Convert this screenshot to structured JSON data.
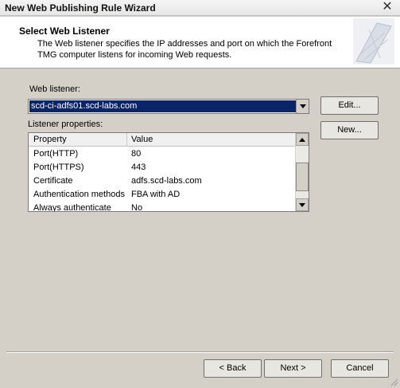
{
  "window": {
    "title": "New Web Publishing Rule Wizard",
    "close_glyph": "✕"
  },
  "header": {
    "title": "Select Web Listener",
    "description": "The Web listener specifies the IP addresses and port on which the Forefront TMG computer listens for incoming Web requests."
  },
  "web_listener": {
    "label": "Web listener:",
    "selected": "scd-ci-adfs01.scd-labs.com",
    "edit_label": "Edit...",
    "new_label": "New..."
  },
  "listener_properties": {
    "label": "Listener properties:",
    "columns": [
      "Property",
      "Value"
    ],
    "rows": [
      {
        "property": "Port(HTTP)",
        "value": "80"
      },
      {
        "property": "Port(HTTPS)",
        "value": "443"
      },
      {
        "property": "Certificate",
        "value": "adfs.scd-labs.com"
      },
      {
        "property": "Authentication methods",
        "value": "FBA with AD"
      },
      {
        "property": "Always authenticate",
        "value": "No"
      }
    ]
  },
  "footer": {
    "back_label": "< Back",
    "next_label": "Next >",
    "cancel_label": "Cancel"
  }
}
